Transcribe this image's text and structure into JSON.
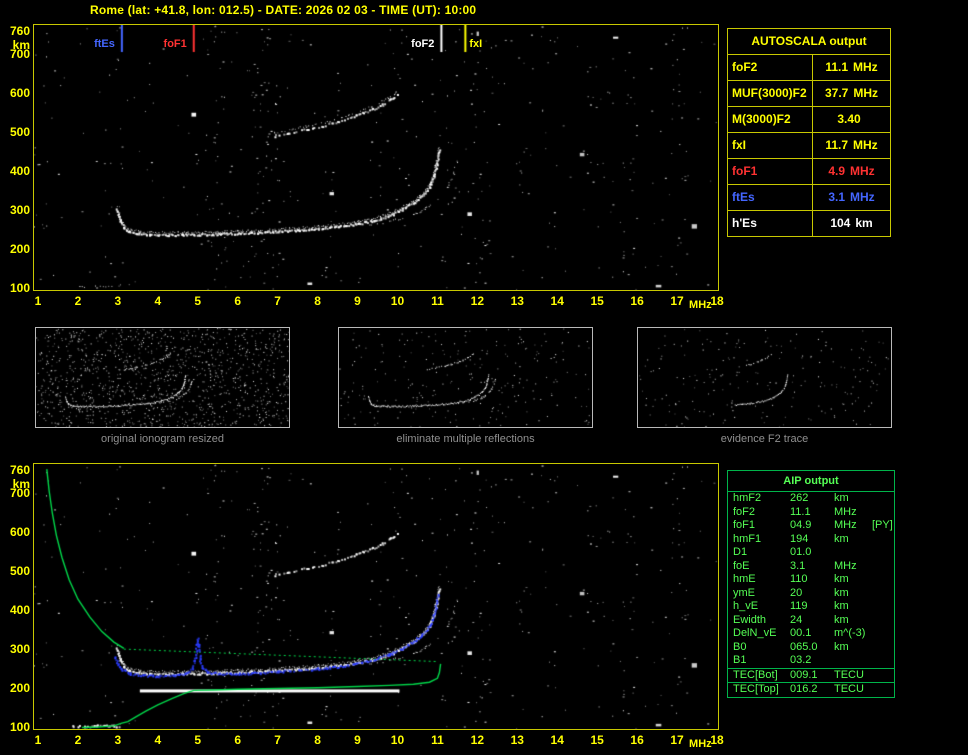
{
  "header": {
    "title": "Rome (lat: +41.8, lon: 012.5) - DATE: 2026 02 03 - TIME (UT): 10:00"
  },
  "colors": {
    "yellow": "#ffff00",
    "plot_border": "#c8c800",
    "red": "#ff3232",
    "blue": "#4466ff",
    "white": "#ffffff",
    "green_line": "#00d84a",
    "aip_border": "#00b44a",
    "aip_text": "#55ff55",
    "caption_gray": "#909090",
    "trace_blue": "#2a3cff"
  },
  "autoscala": {
    "title": "AUTOSCALA output",
    "rows": [
      {
        "label": "foF2",
        "value": "11.1",
        "unit": "MHz",
        "color": "#ffff00"
      },
      {
        "label": "MUF(3000)F2",
        "value": "37.7",
        "unit": "MHz",
        "color": "#ffff00"
      },
      {
        "label": "M(3000)F2",
        "value": "3.40",
        "unit": "",
        "color": "#ffff00"
      },
      {
        "label": "fxI",
        "value": "11.7",
        "unit": "MHz",
        "color": "#ffff00"
      },
      {
        "label": "foF1",
        "value": "4.9",
        "unit": "MHz",
        "color": "#ff3232"
      },
      {
        "label": "ftEs",
        "value": "3.1",
        "unit": "MHz",
        "color": "#4466ff"
      },
      {
        "label": "h'Es",
        "value": "104",
        "unit": "km",
        "color": "#ffffff"
      }
    ]
  },
  "aip": {
    "title": "AIP output",
    "rows": [
      {
        "label": "hmF2",
        "value": "262",
        "unit": "km",
        "extra": ""
      },
      {
        "label": "foF2",
        "value": "11.1",
        "unit": "MHz",
        "extra": ""
      },
      {
        "label": "foF1",
        "value": "04.9",
        "unit": "MHz",
        "extra": "[PY]"
      },
      {
        "label": "hmF1",
        "value": "194",
        "unit": "km",
        "extra": ""
      },
      {
        "label": "D1",
        "value": "01.0",
        "unit": "",
        "extra": ""
      },
      {
        "label": "foE",
        "value": "3.1",
        "unit": "MHz",
        "extra": ""
      },
      {
        "label": "hmE",
        "value": "110",
        "unit": "km",
        "extra": ""
      },
      {
        "label": "ymE",
        "value": "20",
        "unit": "km",
        "extra": ""
      },
      {
        "label": "h_vE",
        "value": "119",
        "unit": "km",
        "extra": ""
      },
      {
        "label": "Ewidth",
        "value": "24",
        "unit": "km",
        "extra": ""
      },
      {
        "label": "DelN_vE",
        "value": "00.1",
        "unit": "m^(-3)",
        "extra": ""
      },
      {
        "label": "B0",
        "value": "065.0",
        "unit": "km",
        "extra": ""
      },
      {
        "label": "B1",
        "value": "03.2",
        "unit": "",
        "extra": ""
      },
      {
        "label": "TEC[Bot]",
        "value": "009.1",
        "unit": "TECU",
        "extra": "",
        "sep": true
      },
      {
        "label": "TEC[Top]",
        "value": "016.2",
        "unit": "TECU",
        "extra": "",
        "sep": true
      }
    ]
  },
  "thumbnails": [
    {
      "caption": "original ionogram resized"
    },
    {
      "caption": "eliminate multiple reflections"
    },
    {
      "caption": "evidence F2 trace"
    }
  ],
  "chart_data": {
    "type": "scatter",
    "description": "Vertical-incidence ionogram: virtual height (km) vs sounding frequency (MHz); top panel = scaled ionogram, bottom panel = same ionogram with restored trace (blue) and electron density profile (green)",
    "xlabel": "MHz",
    "ylabel": "km",
    "xlim": [
      1,
      18
    ],
    "ylim": [
      95,
      775
    ],
    "x_ticks": [
      1,
      2,
      3,
      4,
      5,
      6,
      7,
      8,
      9,
      10,
      11,
      12,
      13,
      14,
      15,
      16,
      17,
      18
    ],
    "y_ticks": [
      760,
      700,
      600,
      500,
      400,
      300,
      200,
      100
    ],
    "markers": [
      {
        "id": "ftEs",
        "label": "ftEs",
        "freq_mhz": 3.1,
        "color": "#4466ff",
        "label_side": "left"
      },
      {
        "id": "foF1",
        "label": "foF1",
        "freq_mhz": 4.9,
        "color": "#ff3232",
        "label_side": "left"
      },
      {
        "id": "foF2",
        "label": "foF2",
        "freq_mhz": 11.1,
        "color": "#ffffff",
        "label_side": "left"
      },
      {
        "id": "fxI",
        "label": "fxI",
        "freq_mhz": 11.7,
        "color": "#ffff00",
        "label_side": "right"
      }
    ],
    "traces": {
      "f_region_ordinary": [
        [
          2.95,
          305
        ],
        [
          3.05,
          272
        ],
        [
          3.15,
          255
        ],
        [
          3.3,
          246
        ],
        [
          3.5,
          242
        ],
        [
          3.8,
          239
        ],
        [
          4.2,
          238
        ],
        [
          4.6,
          238
        ],
        [
          5.0,
          239
        ],
        [
          5.5,
          240
        ],
        [
          6.0,
          242
        ],
        [
          6.5,
          244
        ],
        [
          7.0,
          247
        ],
        [
          7.5,
          250
        ],
        [
          8.0,
          254
        ],
        [
          8.5,
          259
        ],
        [
          9.0,
          266
        ],
        [
          9.4,
          275
        ],
        [
          9.8,
          288
        ],
        [
          10.1,
          302
        ],
        [
          10.4,
          320
        ],
        [
          10.6,
          338
        ],
        [
          10.8,
          362
        ],
        [
          10.9,
          390
        ],
        [
          10.97,
          420
        ],
        [
          11.03,
          455
        ]
      ],
      "f_region_extraordinary": [
        [
          9.3,
          262
        ],
        [
          9.7,
          270
        ],
        [
          10.1,
          280
        ],
        [
          10.5,
          294
        ],
        [
          10.8,
          312
        ],
        [
          11.05,
          334
        ],
        [
          11.25,
          362
        ],
        [
          11.4,
          394
        ],
        [
          11.5,
          430
        ]
      ],
      "second_hop": [
        [
          6.9,
          492
        ],
        [
          7.3,
          500
        ],
        [
          7.7,
          508
        ],
        [
          8.1,
          517
        ],
        [
          8.5,
          528
        ],
        [
          8.9,
          541
        ],
        [
          9.3,
          557
        ],
        [
          9.6,
          572
        ],
        [
          9.85,
          588
        ],
        [
          10.0,
          598
        ]
      ],
      "sporadic_e": [
        [
          1.85,
          104
        ],
        [
          2.15,
          103
        ],
        [
          2.45,
          104
        ],
        [
          2.75,
          104
        ],
        [
          3.0,
          104
        ]
      ]
    },
    "bottom_panel": {
      "profile_topside": [
        [
          1.22,
          762
        ],
        [
          1.28,
          705
        ],
        [
          1.36,
          648
        ],
        [
          1.46,
          592
        ],
        [
          1.6,
          535
        ],
        [
          1.78,
          478
        ],
        [
          2.0,
          428
        ],
        [
          2.3,
          382
        ],
        [
          2.6,
          345
        ],
        [
          2.9,
          318
        ],
        [
          3.15,
          302
        ]
      ],
      "profile_valley_dashed": [
        [
          3.15,
          300
        ],
        [
          11.0,
          268
        ]
      ],
      "profile_bottomside": [
        [
          11.08,
          262
        ],
        [
          11.05,
          240
        ],
        [
          11.0,
          225
        ],
        [
          10.8,
          215
        ],
        [
          10.4,
          210
        ],
        [
          9.8,
          207
        ],
        [
          9.0,
          204
        ],
        [
          8.0,
          201
        ],
        [
          7.0,
          199
        ],
        [
          6.0,
          197
        ],
        [
          5.4,
          195
        ],
        [
          4.9,
          194
        ],
        [
          4.65,
          186
        ],
        [
          4.35,
          173
        ],
        [
          4.0,
          157
        ],
        [
          3.7,
          141
        ],
        [
          3.45,
          126
        ],
        [
          3.25,
          114
        ],
        [
          3.1,
          110
        ],
        [
          2.9,
          103
        ],
        [
          2.5,
          100
        ],
        [
          2.1,
          99
        ]
      ],
      "restored_trace": [
        [
          2.92,
          290
        ],
        [
          3.0,
          268
        ],
        [
          3.1,
          255
        ],
        [
          3.3,
          246
        ],
        [
          3.6,
          242
        ],
        [
          4.0,
          240
        ],
        [
          4.4,
          241
        ],
        [
          4.7,
          245
        ],
        [
          4.85,
          258
        ],
        [
          4.92,
          285
        ],
        [
          4.96,
          320
        ],
        [
          4.98,
          340
        ],
        [
          5.0,
          318
        ],
        [
          5.04,
          283
        ],
        [
          5.1,
          260
        ],
        [
          5.25,
          250
        ],
        [
          5.5,
          246
        ],
        [
          6.0,
          246
        ],
        [
          6.5,
          248
        ],
        [
          7.0,
          251
        ],
        [
          7.5,
          255
        ],
        [
          8.0,
          259
        ],
        [
          8.5,
          264
        ],
        [
          9.0,
          272
        ],
        [
          9.4,
          282
        ],
        [
          9.8,
          296
        ],
        [
          10.1,
          310
        ],
        [
          10.4,
          328
        ],
        [
          10.6,
          346
        ],
        [
          10.8,
          370
        ],
        [
          10.9,
          396
        ],
        [
          10.97,
          425
        ],
        [
          11.0,
          448
        ]
      ],
      "hmF1_line": {
        "km": 194,
        "from_mhz": 3.55,
        "to_mhz": 10.05
      }
    }
  }
}
